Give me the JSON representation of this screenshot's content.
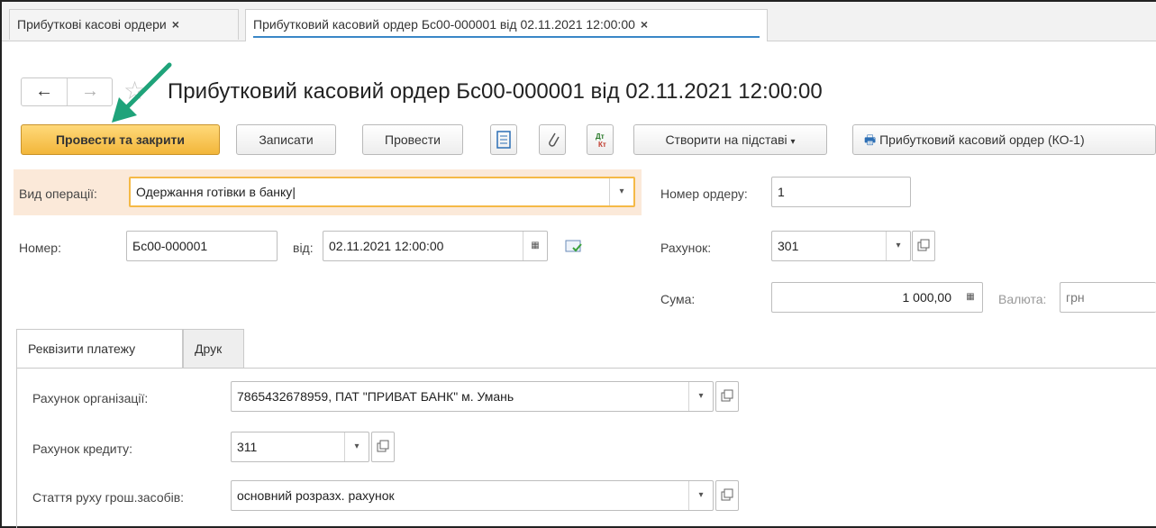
{
  "tabs": [
    {
      "label": "Прибуткові касові ордери",
      "close": "×"
    },
    {
      "label": "Прибутковий касовий ордер Бс00-000001 від 02.11.2021 12:00:00",
      "close": "×"
    }
  ],
  "nav": {
    "back": "←",
    "forward": "→"
  },
  "header": {
    "title": "Прибутковий касовий ордер Бс00-000001 від 02.11.2021 12:00:00"
  },
  "toolbar": {
    "post_close": "Провести та закрити",
    "save": "Записати",
    "post": "Провести",
    "create_based": "Створити на підставі",
    "print": "Прибутковий касовий ордер (КО-1)"
  },
  "form": {
    "operation_label": "Вид операції:",
    "operation_value": "Одержання готівки в банку",
    "order_no_label": "Номер ордеру:",
    "order_no_value": "1",
    "number_label": "Номер:",
    "number_value": "Бс00-000001",
    "from_label": "від:",
    "date_value": "02.11.2021 12:00:00",
    "account_label": "Рахунок:",
    "account_value": "301",
    "sum_label": "Сума:",
    "sum_value": "1 000,00",
    "currency_label": "Валюта:",
    "currency_value": "грн"
  },
  "lower_tabs": [
    "Реквізити платежу",
    "Друк"
  ],
  "payment": {
    "org_account_label": "Рахунок організації:",
    "org_account_value": "7865432678959, ПАТ \"ПРИВАТ БАНК\" м. Умань",
    "credit_account_label": "Рахунок кредиту:",
    "credit_account_value": "311",
    "cashflow_label": "Стаття руху грош.засобів:",
    "cashflow_value": "основний розразх. рахунок"
  },
  "colors": {
    "primary": "#f2b63a",
    "focus": "#f5b946",
    "arrow": "#1fa37a",
    "tab_underline": "#3a87c7"
  }
}
